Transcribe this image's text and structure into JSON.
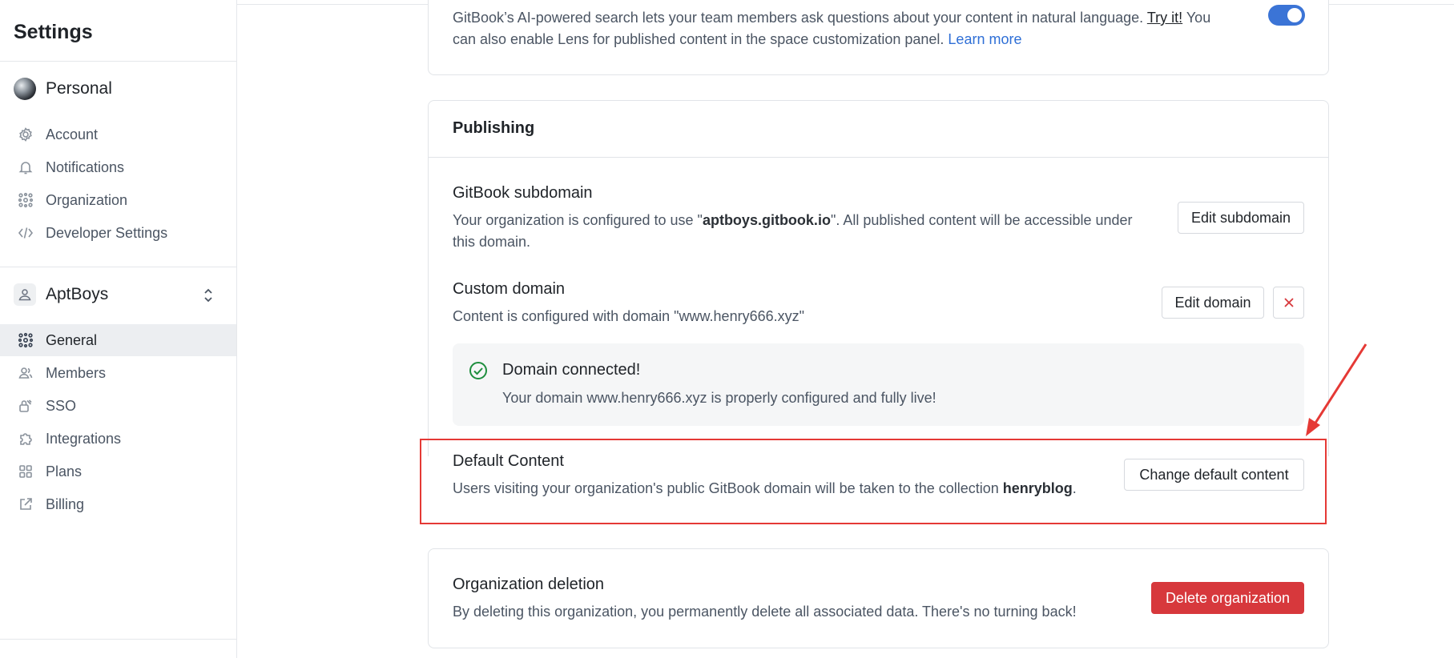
{
  "sidebar": {
    "title": "Settings",
    "personal_label": "Personal",
    "personal_items": [
      {
        "label": "Account",
        "icon": "gear-icon"
      },
      {
        "label": "Notifications",
        "icon": "bell-icon"
      },
      {
        "label": "Organization",
        "icon": "organization-icon"
      },
      {
        "label": "Developer Settings",
        "icon": "code-icon"
      }
    ],
    "org_label": "AptBoys",
    "org_items": [
      {
        "label": "General",
        "icon": "organization-icon",
        "active": true
      },
      {
        "label": "Members",
        "icon": "members-icon"
      },
      {
        "label": "SSO",
        "icon": "sso-icon"
      },
      {
        "label": "Integrations",
        "icon": "puzzle-icon"
      },
      {
        "label": "Plans",
        "icon": "grid-icon"
      },
      {
        "label": "Billing",
        "icon": "external-link-icon"
      }
    ]
  },
  "lens": {
    "text_before": "GitBook’s AI-powered search lets your team members ask questions about your content in natural language. ",
    "try_link": "Try it!",
    "text_middle": " You",
    "text_line2": "can also enable Lens for published content in the space customization panel. ",
    "learn_more": "Learn more",
    "toggle_on": true
  },
  "publishing": {
    "title": "Publishing",
    "subdomain": {
      "heading": "GitBook subdomain",
      "desc_before": "Your organization is configured to use \"",
      "domain": "aptboys.gitbook.io",
      "desc_after": "\". All published content will be accessible under",
      "desc_line2": "this domain.",
      "button": "Edit subdomain"
    },
    "custom_domain": {
      "heading": "Custom domain",
      "desc": "Content is configured with domain \"www.henry666.xyz\"",
      "button": "Edit domain",
      "remove_icon": "close-icon"
    },
    "notice": {
      "title": "Domain connected!",
      "body": "Your domain www.henry666.xyz is properly configured and fully live!",
      "icon": "check-circle-icon"
    },
    "default_content": {
      "heading": "Default Content",
      "desc_before": "Users visiting your organization's public GitBook domain will be taken to the collection ",
      "collection": "henryblog",
      "desc_after": ".",
      "button": "Change default content"
    }
  },
  "deletion": {
    "heading": "Organization deletion",
    "desc": "By deleting this organization, you permanently delete all associated data. There's no turning back!",
    "button": "Delete organization"
  },
  "colors": {
    "accent": "#3b74d6",
    "danger": "#d7383c",
    "highlight": "#e53935",
    "success": "#1e8e3e"
  }
}
